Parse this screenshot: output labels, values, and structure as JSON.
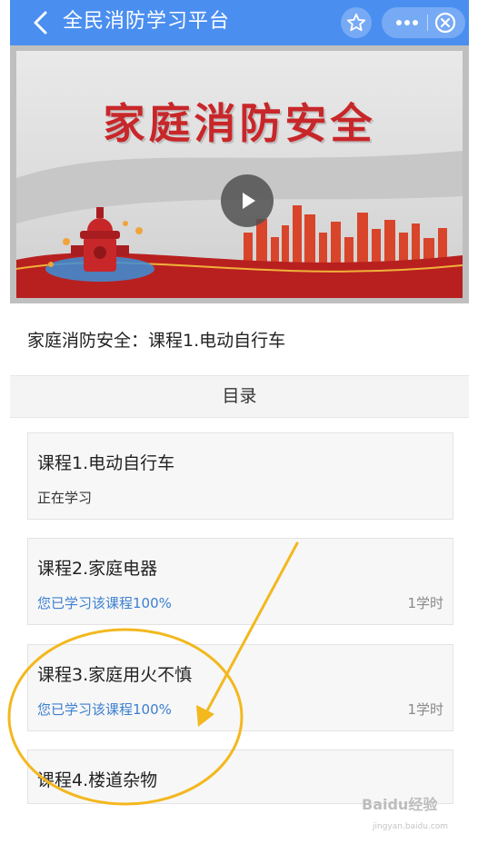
{
  "header": {
    "title": "全民消防学习平台",
    "back_icon": "chevron-left-icon",
    "favorite_icon": "star-icon",
    "more_icon": "more-dots-icon",
    "close_icon": "close-circle-icon",
    "bg_color": "#4a8ef0"
  },
  "banner": {
    "title": "家庭消防安全",
    "play_icon": "play-icon",
    "title_color": "#c8272a"
  },
  "course": {
    "heading": "家庭消防安全：课程1.电动自行车"
  },
  "catalog": {
    "label": "目录",
    "items": [
      {
        "name": "课程1.电动自行车",
        "status": "正在学习",
        "hours": ""
      },
      {
        "name": "课程2.家庭电器",
        "status": "您已学习该课程100%",
        "hours": "1学时"
      },
      {
        "name": "课程3.家庭用火不慎",
        "status": "您已学习该课程100%",
        "hours": "1学时"
      },
      {
        "name": "课程4.楼道杂物",
        "status": "",
        "hours": ""
      }
    ]
  },
  "watermark": {
    "brand": "Baidu经验",
    "url": "jingyan.baidu.com"
  },
  "colors": {
    "accent_blue_text": "#3c7fd0",
    "annotation": "#f3b81e"
  }
}
